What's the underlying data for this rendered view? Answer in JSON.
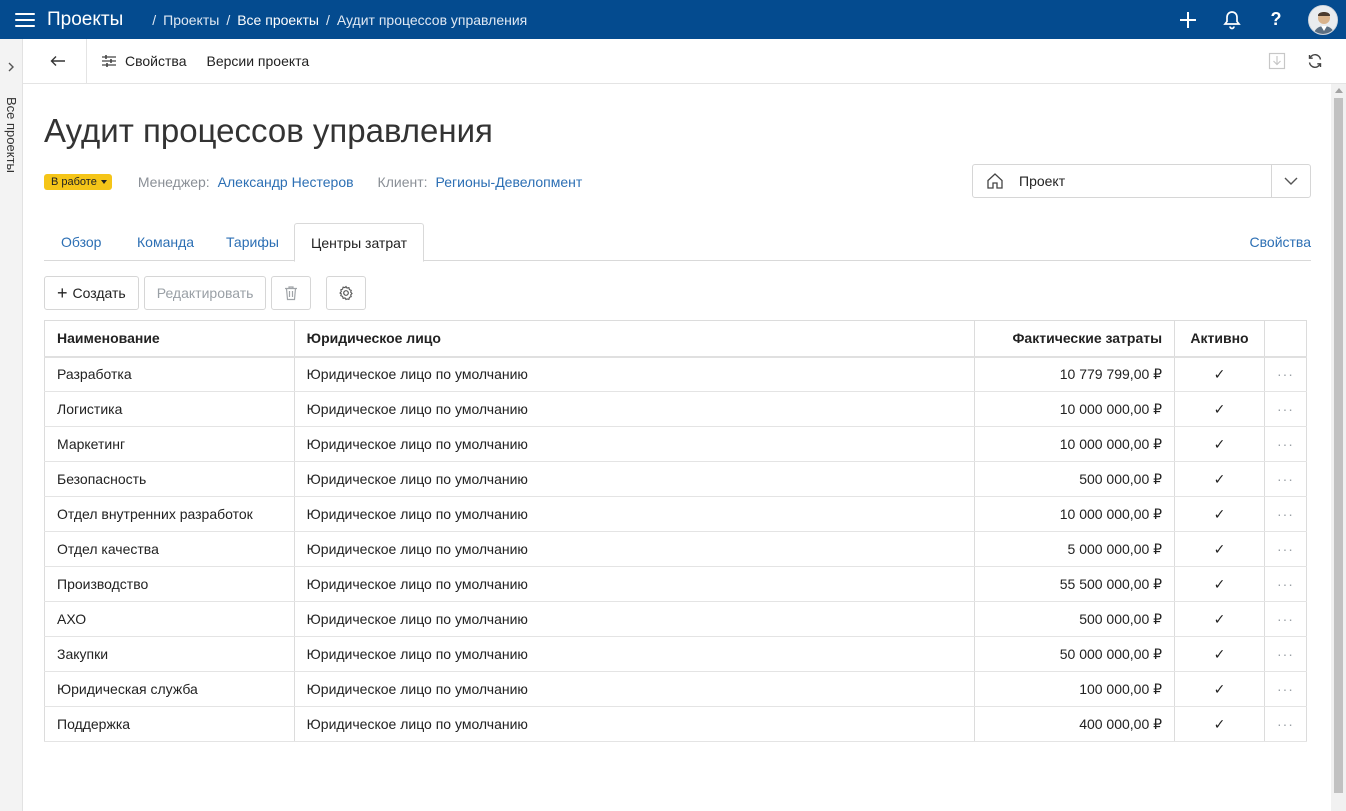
{
  "topbar": {
    "app_title": "Проекты",
    "breadcrumbs": [
      "Проекты",
      "Все проекты",
      "Аудит процессов управления"
    ],
    "icons": [
      "plus-icon",
      "bell-icon",
      "help-icon",
      "avatar"
    ]
  },
  "rail": {
    "label": "Все проекты"
  },
  "toolbar": {
    "properties_label": "Свойства",
    "versions_label": "Версии проекта"
  },
  "header": {
    "title": "Аудит процессов управления",
    "status": "В работе",
    "manager_label": "Менеджер:",
    "manager": "Александр Нестеров",
    "client_label": "Клиент:",
    "client": "Регионы-Девелопмент",
    "project_select": "Проект"
  },
  "tabs": [
    {
      "label": "Обзор"
    },
    {
      "label": "Команда"
    },
    {
      "label": "Тарифы"
    },
    {
      "label": "Центры затрат"
    }
  ],
  "tabs_right_link": "Свойства",
  "actions": {
    "create": "Создать",
    "edit": "Редактировать"
  },
  "table": {
    "columns": [
      "Наименование",
      "Юридическое лицо",
      "Фактические затраты",
      "Активно"
    ],
    "rows": [
      {
        "name": "Разработка",
        "entity": "Юридическое лицо по умолчанию",
        "cost": "10 779 799,00 ₽",
        "active": "✓"
      },
      {
        "name": "Логистика",
        "entity": "Юридическое лицо по умолчанию",
        "cost": "10 000 000,00 ₽",
        "active": "✓"
      },
      {
        "name": "Маркетинг",
        "entity": "Юридическое лицо по умолчанию",
        "cost": "10 000 000,00 ₽",
        "active": "✓"
      },
      {
        "name": "Безопасность",
        "entity": "Юридическое лицо по умолчанию",
        "cost": "500 000,00 ₽",
        "active": "✓"
      },
      {
        "name": "Отдел внутренних разработок",
        "entity": "Юридическое лицо по умолчанию",
        "cost": "10 000 000,00 ₽",
        "active": "✓"
      },
      {
        "name": "Отдел качества",
        "entity": "Юридическое лицо по умолчанию",
        "cost": "5 000 000,00 ₽",
        "active": "✓"
      },
      {
        "name": "Производство",
        "entity": "Юридическое лицо по умолчанию",
        "cost": "55 500 000,00 ₽",
        "active": "✓"
      },
      {
        "name": "АХО",
        "entity": "Юридическое лицо по умолчанию",
        "cost": "500 000,00 ₽",
        "active": "✓"
      },
      {
        "name": "Закупки",
        "entity": "Юридическое лицо по умолчанию",
        "cost": "50 000 000,00 ₽",
        "active": "✓"
      },
      {
        "name": "Юридическая служба",
        "entity": "Юридическое лицо по умолчанию",
        "cost": "100 000,00 ₽",
        "active": "✓"
      },
      {
        "name": "Поддержка",
        "entity": "Юридическое лицо по умолчанию",
        "cost": "400 000,00 ₽",
        "active": "✓"
      }
    ],
    "row_menu": "···"
  },
  "colors": {
    "topbar": "#044b8f",
    "link": "#2c6fb4",
    "status_badge": "#f5c518"
  }
}
